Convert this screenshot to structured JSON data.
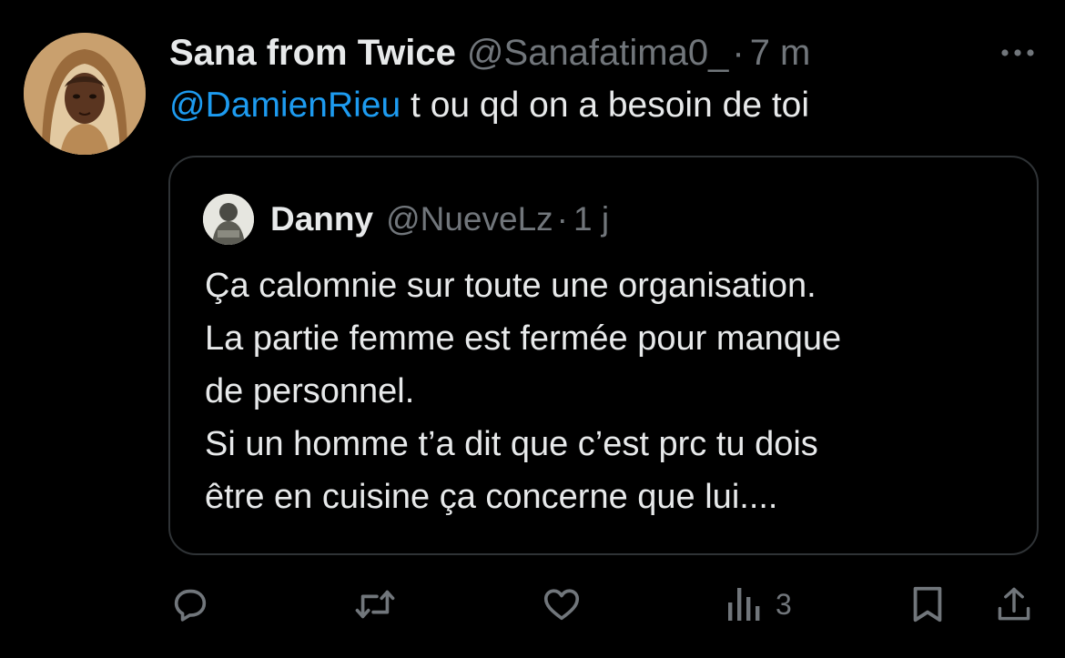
{
  "tweet": {
    "display_name": "Sana from Twice",
    "handle": "@Sanafatima0_",
    "separator": "·",
    "time": "7 m",
    "reply_mention": "@DamienRieu",
    "reply_text": " t ou qd on a besoin de toi"
  },
  "quote": {
    "display_name": "Danny",
    "handle": "@NueveLz",
    "separator": "·",
    "time": "1 j",
    "lines": [
      "Ça calomnie sur toute une organisation.",
      "La partie femme est fermée pour manque",
      "de personnel.",
      "Si un homme t’a dit que c’est prc tu dois",
      "être en cuisine ça concerne que lui...."
    ]
  },
  "actions": {
    "views": "3",
    "icons": [
      "reply-icon",
      "retweet-icon",
      "like-icon",
      "views-icon",
      "bookmark-icon",
      "share-icon"
    ]
  },
  "colors": {
    "background": "#000000",
    "text": "#e7e9ea",
    "muted": "#71767b",
    "link": "#1d9bf0",
    "border": "#2f3336"
  }
}
